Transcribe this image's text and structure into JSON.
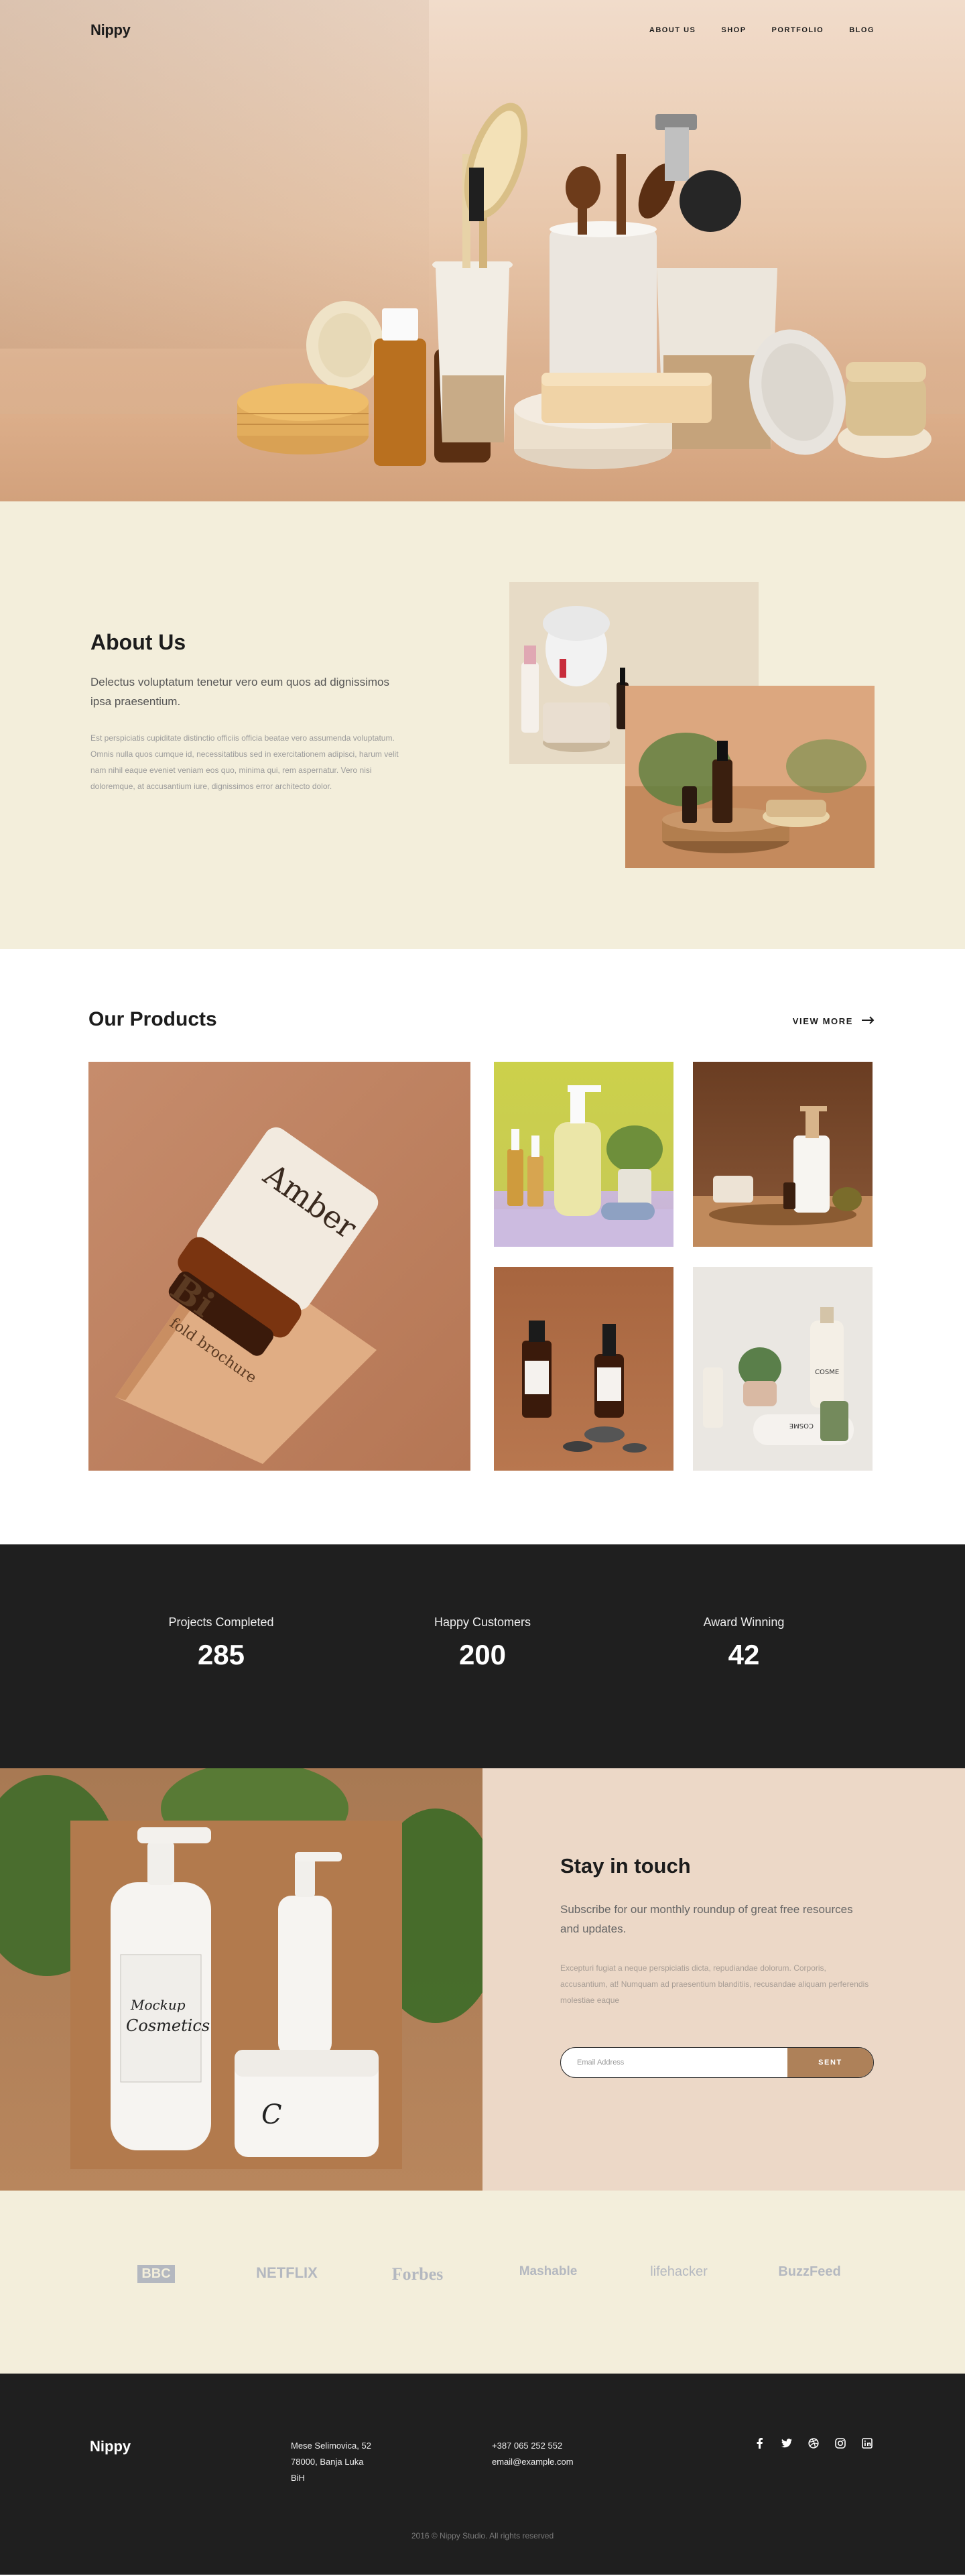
{
  "header": {
    "logo": "Nippy",
    "nav": [
      "ABOUT US",
      "SHOP",
      "PORTFOLIO",
      "BLOG"
    ]
  },
  "about": {
    "title": "About Us",
    "lead": "Delectus voluptatum tenetur vero eum quos ad dignissimos ipsa praesentium.",
    "body": "Est perspiciatis cupiditate distinctio officiis officia beatae vero assumenda voluptatum. Omnis nulla quos cumque id, necessitatibus sed in exercitationem adipisci, harum velit nam nihil eaque eveniet veniam eos quo, minima qui, rem aspernatur. Vero nisi doloremque, at accusantium iure, dignissimos error architecto dolor."
  },
  "products": {
    "title": "Our Products",
    "view_more": "VIEW MORE",
    "big_bottle_label": "Amber",
    "big_brochure_label": "Bi",
    "big_brochure_sub": "fold brochure",
    "p4_label_a": "COSME",
    "p4_label_b": "COSME"
  },
  "stats": [
    {
      "label": "Projects Completed",
      "value": "285"
    },
    {
      "label": "Happy Customers",
      "value": "200"
    },
    {
      "label": "Award Winning",
      "value": "42"
    }
  ],
  "touch": {
    "title": "Stay in touch",
    "lead": "Subscribe for our monthly roundup of great free resources and updates.",
    "body": "Excepturi fugiat a neque perspiciatis dicta, repudiandae dolorum. Corporis, accusantium, at! Numquam ad praesentium blanditiis, recusandae aliquam perferendis molestiae eaque",
    "email_placeholder": "Email Address",
    "send_label": "SENT",
    "mockup_text": "Mockup",
    "cosmetics_text": "Cosmetics"
  },
  "brands": [
    "BBC",
    "NETFLIX",
    "Forbes",
    "Mashable",
    "lifehacker",
    "BuzzFeed"
  ],
  "footer": {
    "logo": "Nippy",
    "address": [
      "Mese Selimovica, 52",
      "78000, Banja Luka",
      "BiH"
    ],
    "phone": "+387 065 252 552",
    "email": "email@example.com",
    "social": [
      "facebook-icon",
      "twitter-icon",
      "dribbble-icon",
      "instagram-icon",
      "linkedin-icon"
    ],
    "copyright": "2016 © Nippy Studio. All rights reserved"
  },
  "colors": {
    "cream": "#f3eedb",
    "dark": "#1f1f1f",
    "accent": "#ae8159",
    "peach": "#ecd8c7"
  }
}
